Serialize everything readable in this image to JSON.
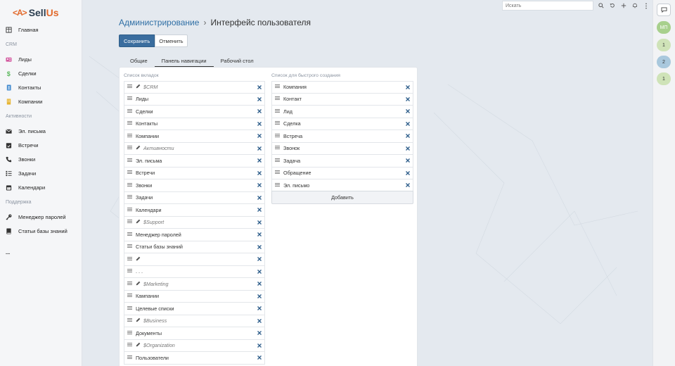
{
  "logo": {
    "mark": "<A>",
    "sell": "Sell",
    "us": "Us"
  },
  "sidebar": {
    "items": [
      {
        "type": "item",
        "label": "Главная",
        "icon": "table-icon"
      },
      {
        "type": "group",
        "label": "CRM"
      },
      {
        "type": "item",
        "label": "Лиды",
        "icon": "id-card-icon",
        "color": "#d35ba0"
      },
      {
        "type": "item",
        "label": "Сделки",
        "icon": "dollar-icon",
        "color": "#5bb85d"
      },
      {
        "type": "item",
        "label": "Контакты",
        "icon": "address-book-icon",
        "color": "#4a8fd1"
      },
      {
        "type": "item",
        "label": "Компании",
        "icon": "building-icon",
        "color": "#e6b432"
      },
      {
        "type": "group",
        "label": "Активности"
      },
      {
        "type": "item",
        "label": "Эл. письма",
        "icon": "envelope-icon"
      },
      {
        "type": "item",
        "label": "Встречи",
        "icon": "calendar-check-icon"
      },
      {
        "type": "item",
        "label": "Звонки",
        "icon": "phone-icon"
      },
      {
        "type": "item",
        "label": "Задачи",
        "icon": "tasks-icon"
      },
      {
        "type": "item",
        "label": "Календари",
        "icon": "calendar-icon"
      },
      {
        "type": "group",
        "label": "Поддержка"
      },
      {
        "type": "item",
        "label": "Менеджер паролей",
        "icon": "key-icon"
      },
      {
        "type": "item",
        "label": "Статьи базы знаний",
        "icon": "book-icon"
      }
    ],
    "more": "..."
  },
  "topbar": {
    "search_placeholder": "Искать"
  },
  "rightbar": {
    "badges": [
      {
        "text": "МП",
        "color": "#a8d08d"
      },
      {
        "text": "1",
        "color": "#cfe3b8"
      },
      {
        "text": "2",
        "color": "#a9c8dd"
      },
      {
        "text": "1",
        "color": "#cfe3b8"
      }
    ]
  },
  "header": {
    "link": "Администрирование",
    "sep": "›",
    "current": "Интерфейс пользователя"
  },
  "buttons": {
    "save": "Сохранить",
    "cancel": "Отменить"
  },
  "tabs": [
    "Общие",
    "Панель навигации",
    "Рабочий стол"
  ],
  "active_tab": 1,
  "tab_list": {
    "title": "Список вкладок",
    "rows": [
      {
        "label": "$CRM",
        "group": true
      },
      {
        "label": "Лиды"
      },
      {
        "label": "Сделки"
      },
      {
        "label": "Контакты"
      },
      {
        "label": "Компании"
      },
      {
        "label": "Активности",
        "group": true
      },
      {
        "label": "Эл. письма"
      },
      {
        "label": "Встречи"
      },
      {
        "label": "Звонки"
      },
      {
        "label": "Задачи"
      },
      {
        "label": "Календари"
      },
      {
        "label": "$Support",
        "group": true
      },
      {
        "label": "Менеджер паролей"
      },
      {
        "label": "Статьи базы знаний"
      },
      {
        "label": "",
        "group": true
      },
      {
        "label": ". . ."
      },
      {
        "label": "$Marketing",
        "group": true
      },
      {
        "label": "Кампании"
      },
      {
        "label": "Целевые списки"
      },
      {
        "label": "$Business",
        "group": true
      },
      {
        "label": "Документы"
      },
      {
        "label": "$Organization",
        "group": true
      },
      {
        "label": "Пользователи"
      }
    ]
  },
  "quick_list": {
    "title": "Список для быстрого создания",
    "rows": [
      {
        "label": "Компания"
      },
      {
        "label": "Контакт"
      },
      {
        "label": "Лид"
      },
      {
        "label": "Сделка"
      },
      {
        "label": "Встреча"
      },
      {
        "label": "Звонок"
      },
      {
        "label": "Задача"
      },
      {
        "label": "Обращение"
      },
      {
        "label": "Эл. письмо"
      }
    ],
    "add_label": "Добавить"
  }
}
